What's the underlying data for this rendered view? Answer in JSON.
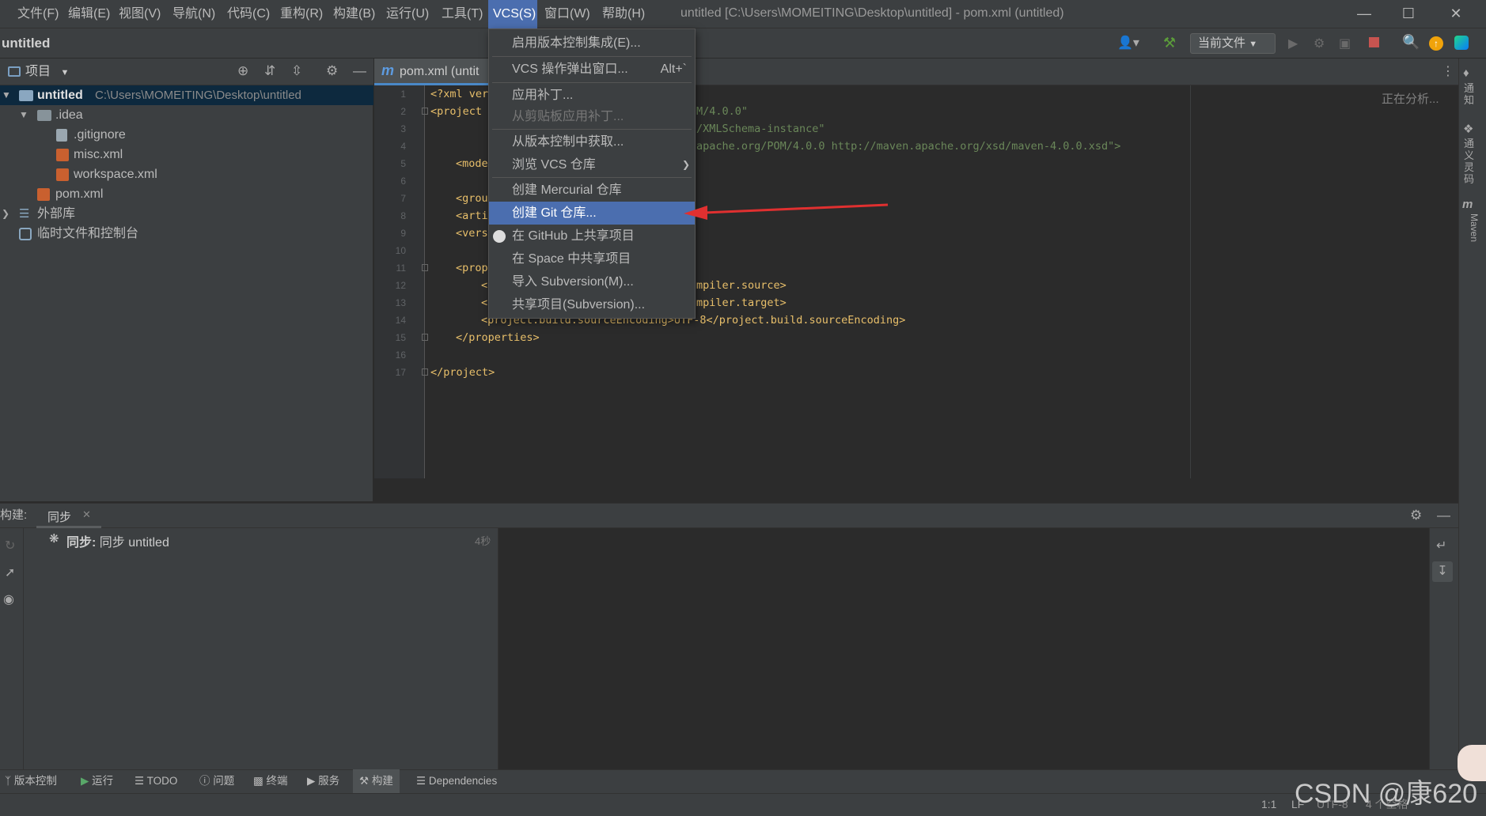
{
  "menubar": {
    "items": [
      "文件(F)",
      "编辑(E)",
      "视图(V)",
      "导航(N)",
      "代码(C)",
      "重构(R)",
      "构建(B)",
      "运行(U)",
      "工具(T)",
      "VCS(S)",
      "窗口(W)",
      "帮助(H)"
    ],
    "window_title": "untitled [C:\\Users\\MOMEITING\\Desktop\\untitled] - pom.xml (untitled)"
  },
  "toolbar": {
    "project_name": "untitled",
    "run_config": "当前文件"
  },
  "project_panel": {
    "title": "项目",
    "tree": [
      {
        "label": "untitled",
        "path": "C:\\Users\\MOMEITING\\Desktop\\untitled"
      },
      {
        "label": ".idea"
      },
      {
        "label": ".gitignore"
      },
      {
        "label": "misc.xml"
      },
      {
        "label": "workspace.xml"
      },
      {
        "label": "pom.xml"
      },
      {
        "label": "外部库"
      },
      {
        "label": "临时文件和控制台"
      }
    ]
  },
  "editor": {
    "tab_label": "pom.xml (untit",
    "status_hint": "正在分析...",
    "line_numbers": [
      "1",
      "2",
      "3",
      "4",
      "5",
      "6",
      "7",
      "8",
      "9",
      "10",
      "11",
      "12",
      "13",
      "14",
      "15",
      "16",
      "17"
    ],
    "lines": [
      "<?xml ver",
      "<project ",
      "M/4.0.0\"",
      "/XMLSchema-instance\"",
      "apache.org/POM/4.0.0 http://maven.apache.org/xsd/maven-4.0.0.xsd\">",
      "<mode",
      "<grou",
      "<arti",
      "<vers",
      "<prop",
      "mpiler.source>",
      "mpiler.target>",
      "<project.build.sourceEncoding>UTF-8</project.build.sourceEncoding>",
      "</properties>",
      "</project>",
      "<",
      "<"
    ]
  },
  "vcs_menu": {
    "items": [
      {
        "label": "启用版本控制集成(E)..."
      },
      {
        "label": "VCS 操作弹出窗口...",
        "shortcut": "Alt+`"
      },
      {
        "label": "应用补丁..."
      },
      {
        "label": "从剪贴板应用补丁..."
      },
      {
        "label": "从版本控制中获取..."
      },
      {
        "label": "浏览 VCS 仓库"
      },
      {
        "label": "创建 Mercurial 仓库"
      },
      {
        "label": "创建 Git 仓库..."
      },
      {
        "label": "在 GitHub 上共享项目"
      },
      {
        "label": "在 Space 中共享项目"
      },
      {
        "label": "导入 Subversion(M)..."
      },
      {
        "label": "共享项目(Subversion)..."
      }
    ]
  },
  "build_panel": {
    "label": "构建:",
    "tab": "同步",
    "sync_bold": "同步:",
    "sync_text": "同步 untitled",
    "duration": "4秒"
  },
  "bottom_tools": [
    "版本控制",
    "运行",
    "TODO",
    "问题",
    "终端",
    "服务",
    "构建",
    "Dependencies"
  ],
  "right_strip": [
    "通知",
    "通义灵码",
    "Maven"
  ],
  "statusbar": {
    "position": "1:1",
    "line_sep": "LF",
    "encoding": "UTF-8",
    "indent": "4 个空格"
  },
  "watermark": "CSDN @康620",
  "colors": {
    "accent": "#4b6eaf",
    "arrow": "#e03030",
    "bg_dark": "#2b2b2b",
    "panel": "#3c3f41"
  }
}
